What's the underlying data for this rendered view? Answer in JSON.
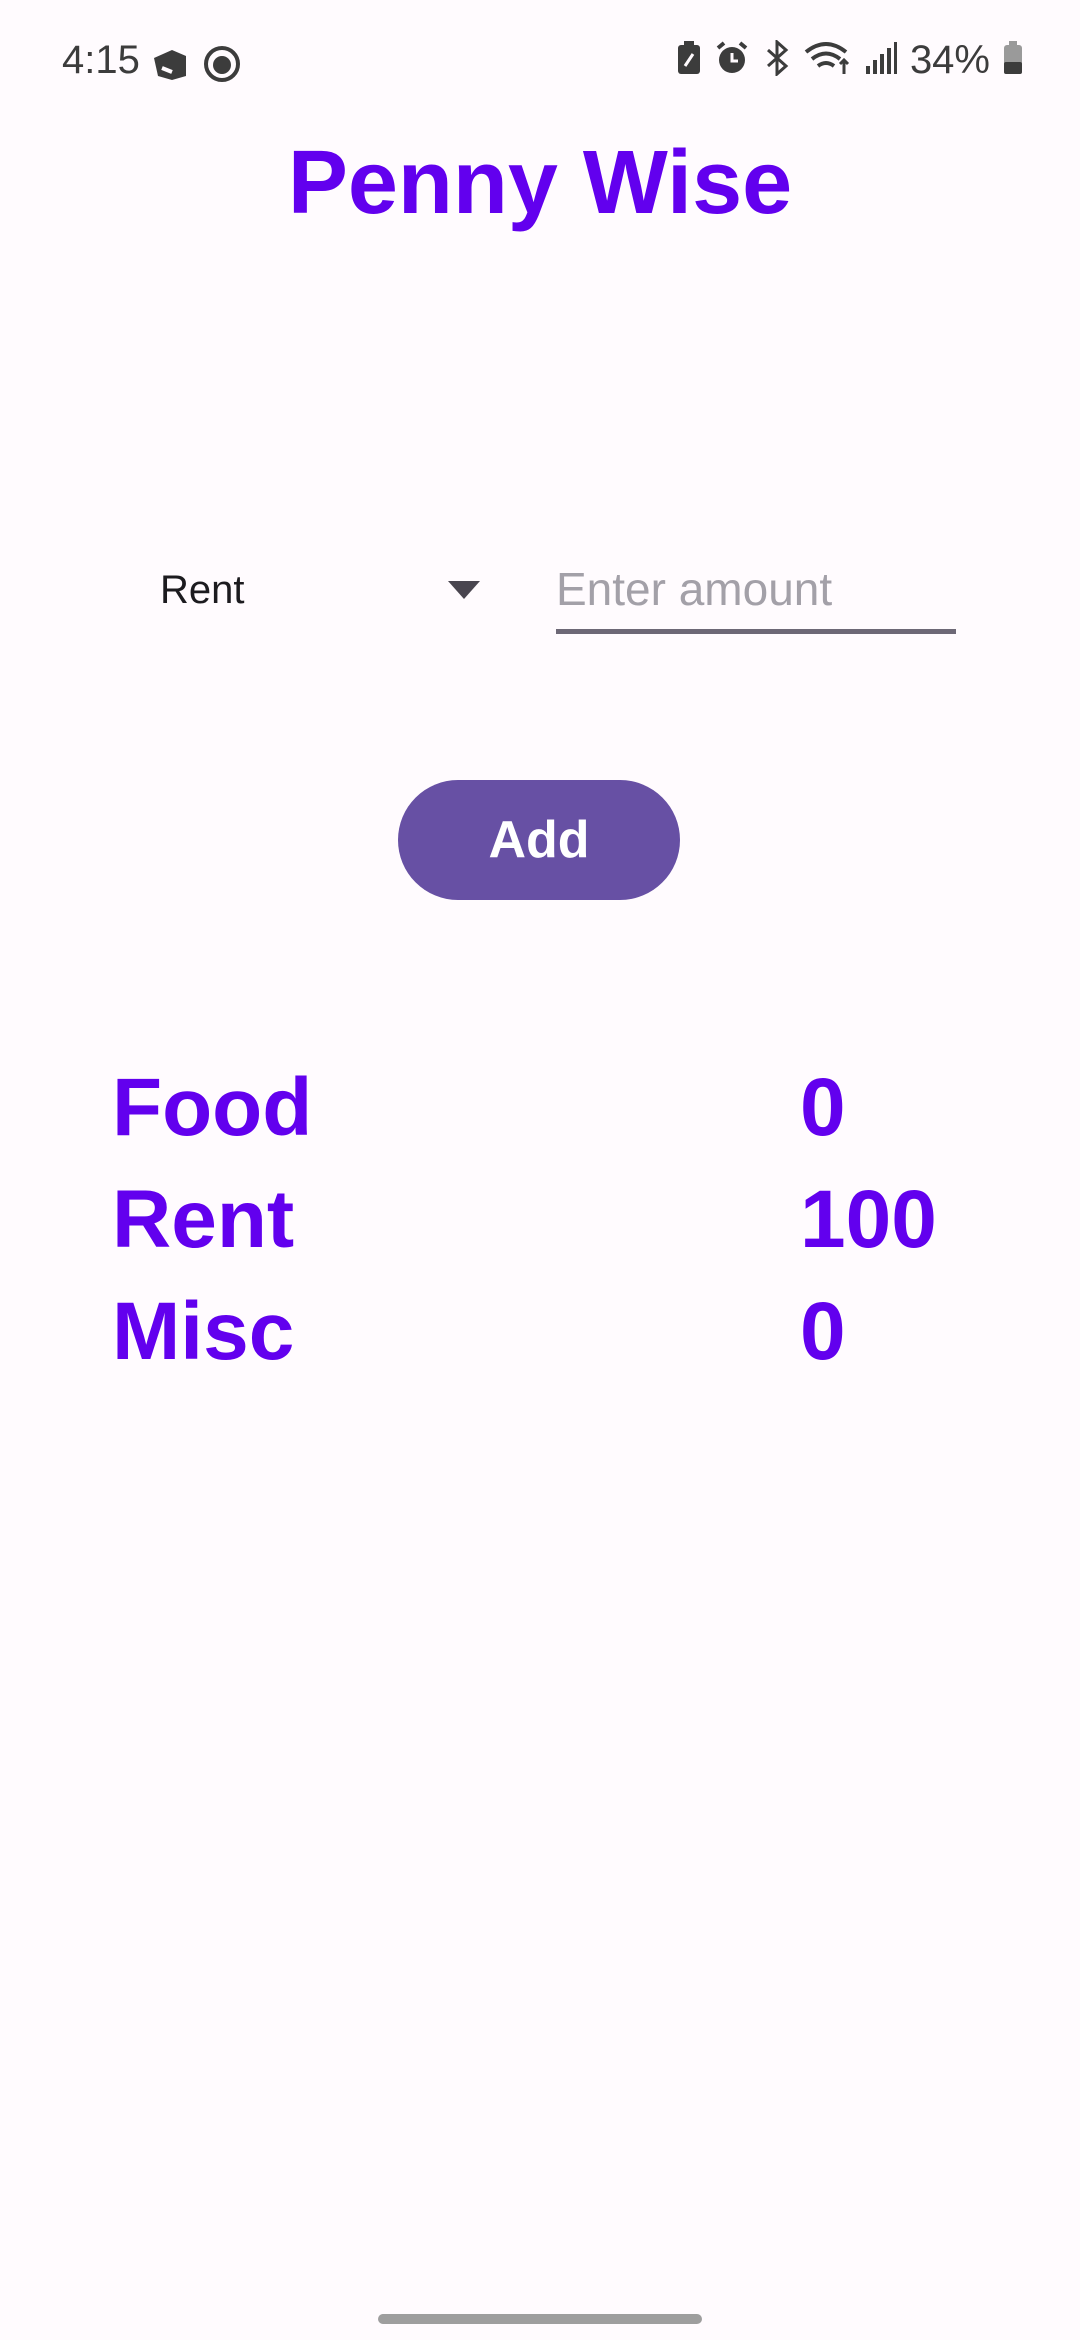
{
  "status_bar": {
    "time": "4:15",
    "battery_percent": "34%",
    "left_icons": [
      "graduation-cap-icon",
      "cat-face-icon"
    ],
    "right_icons": [
      "battery-saver-icon",
      "alarm-icon",
      "bluetooth-icon",
      "wifi-icon",
      "signal-icon",
      "battery-icon"
    ]
  },
  "app": {
    "title": "Penny Wise"
  },
  "form": {
    "category_selected": "Rent",
    "amount_placeholder": "Enter amount",
    "amount_value": "",
    "add_label": "Add"
  },
  "totals": [
    {
      "label": "Food",
      "value": "0"
    },
    {
      "label": "Rent",
      "value": "100"
    },
    {
      "label": "Misc",
      "value": "0"
    }
  ],
  "colors": {
    "accent": "#6200ee",
    "button": "#6750a4",
    "background": "#fffbfe"
  }
}
